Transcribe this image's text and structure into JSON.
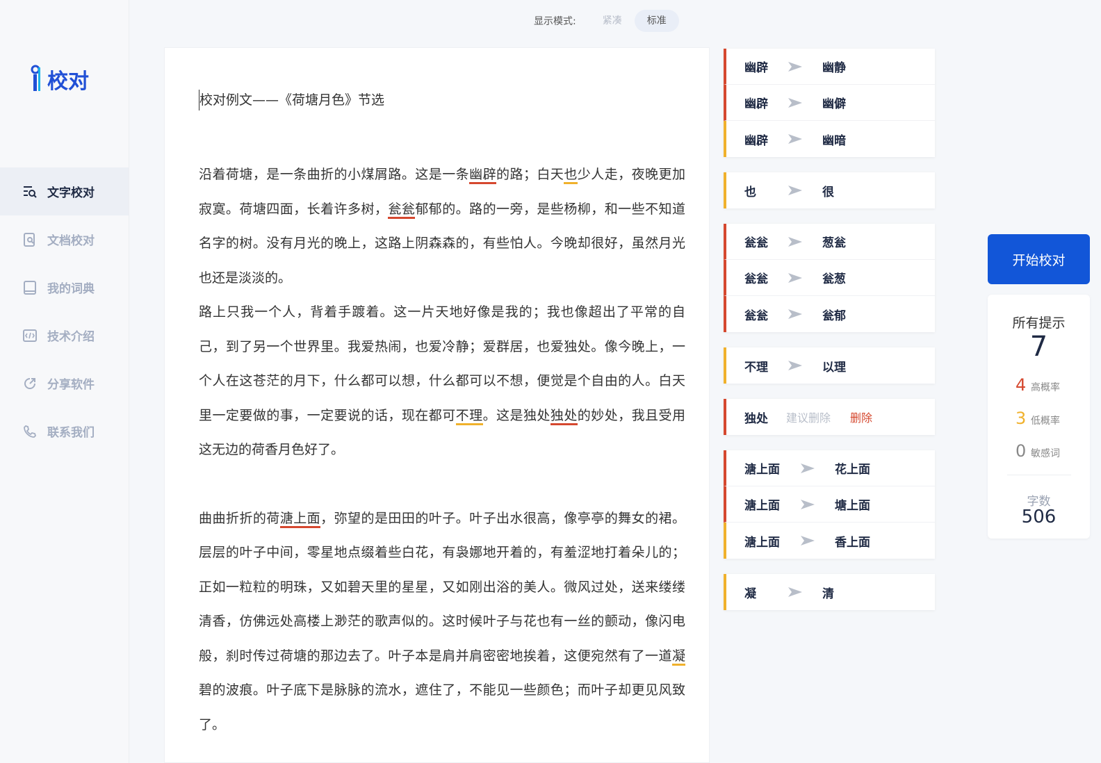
{
  "logo": {
    "text": "校对"
  },
  "nav": [
    {
      "label": "文字校对",
      "icon": "text-check-icon",
      "active": true
    },
    {
      "label": "文档校对",
      "icon": "document-check-icon"
    },
    {
      "label": "我的词典",
      "icon": "dictionary-icon"
    },
    {
      "label": "技术介绍",
      "icon": "tech-icon"
    },
    {
      "label": "分享软件",
      "icon": "share-icon"
    },
    {
      "label": "联系我们",
      "icon": "phone-icon"
    }
  ],
  "mode": {
    "label": "显示模式:",
    "options": [
      "紧凑",
      "标准"
    ],
    "selected": "标准"
  },
  "doc": {
    "title": "校对例文——《荷塘月色》节选",
    "p1": [
      "沿着荷塘，是一条曲折的小煤屑路。这是一条",
      "幽辟",
      "的路；白天",
      "也",
      "少人走，夜晚更加寂寞。荷塘四面，长着许多树，",
      "瓮瓮",
      "郁郁的。路的一旁，是些杨柳，和一些不知道名字的树。没有月光的晚上，这路上阴森森的，有些怕人。今晚却很好，虽然月光也还是淡淡的。"
    ],
    "p2": [
      "路上只我一个人，背着手踱着。这一片天地好像是我的；我也像超出了平常的自己，到了另一个世界里。我爱热闹，也爱冷静；爱群居，也爱独处。像今晚上，一个人在这苍茫的月下，什么都可以想，什么都可以不想，便觉是个自由的人。白天里一定要做的事，一定要说的话，现在都可",
      "不理",
      "。这是独处",
      "独处",
      "的妙处，我且受用这无边的荷香月色好了。"
    ],
    "p3": [
      "曲曲折折的荷",
      "溏上面",
      "，弥望的是田田的叶子。叶子出水很高，像亭亭的舞女的裙。层层的叶子中间，零星地点缀着些白花，有袅娜地开着的，有羞涩地打着朵儿的；正如一粒粒的明珠，又如碧天里的星星，又如刚出浴的美人。微风过处，送来缕缕清香，仿佛远处高楼上渺茫的歌声似的。这时候叶子与花也有一丝的颤动，像闪电般，刹时传过荷塘的那边去了。叶子本是肩并肩密密地挨着，这便宛然有了一道",
      "凝",
      "碧的波痕。叶子底下是脉脉的流水，遮住了，不能见一些颜色；而叶子却更见风致了。"
    ]
  },
  "suggestions": [
    {
      "rows": [
        {
          "from": "幽辟",
          "to": "幽静",
          "color": "red"
        },
        {
          "from": "幽辟",
          "to": "幽僻",
          "color": "red"
        },
        {
          "from": "幽辟",
          "to": "幽暗",
          "color": "yellow"
        }
      ]
    },
    {
      "rows": [
        {
          "from": "也",
          "to": "很",
          "color": "yellow"
        }
      ]
    },
    {
      "rows": [
        {
          "from": "瓮瓮",
          "to": "葱瓮",
          "color": "red"
        },
        {
          "from": "瓮瓮",
          "to": "瓮葱",
          "color": "red"
        },
        {
          "from": "瓮瓮",
          "to": "瓮郁",
          "color": "red"
        }
      ]
    },
    {
      "rows": [
        {
          "from": "不理",
          "to": "以理",
          "color": "yellow"
        }
      ]
    },
    {
      "rows": [
        {
          "from": "独处",
          "hint": "建议删除",
          "action": "删除",
          "color": "red"
        }
      ]
    },
    {
      "rows": [
        {
          "from": "溏上面",
          "to": "花上面",
          "color": "red"
        },
        {
          "from": "溏上面",
          "to": "塘上面",
          "color": "red"
        },
        {
          "from": "溏上面",
          "to": "香上面",
          "color": "yellow"
        }
      ]
    },
    {
      "rows": [
        {
          "from": "凝",
          "to": "清",
          "color": "yellow"
        }
      ]
    }
  ],
  "start_button": "开始校对",
  "stats": {
    "title": "所有提示",
    "total": "7",
    "high": {
      "count": "4",
      "label": "高概率",
      "color": "#d5482f"
    },
    "low": {
      "count": "3",
      "label": "低概率",
      "color": "#f0b12c"
    },
    "sensitive": {
      "count": "0",
      "label": "敏感词",
      "color": "#888888"
    },
    "words_label": "字数",
    "words": "506"
  }
}
